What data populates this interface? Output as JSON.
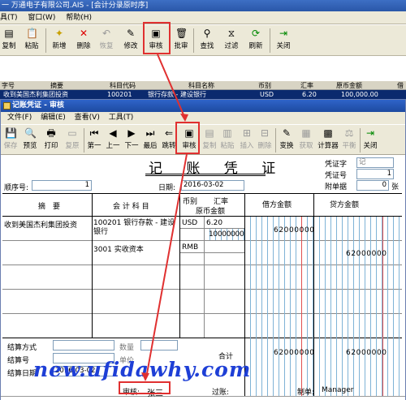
{
  "outer": {
    "title": "一 万通电子有限公司.AIS - [会计分录原时序]",
    "menu": [
      "具(T)",
      "窗口(W)",
      "帮助(H)"
    ],
    "toolbar": [
      "复制",
      "粘贴",
      "新增",
      "删除",
      "恢复",
      "修改",
      "审核",
      "批审",
      "查找",
      "过滤",
      "刷新",
      "关闭"
    ],
    "grid": {
      "headers": [
        "字号",
        "摘要",
        "科目代码",
        "科目名称",
        "币别",
        "汇率",
        "原币金额",
        "借"
      ],
      "row": [
        "",
        "收到美国杰利集团投资",
        "100201",
        "银行存款 - 建设银行",
        "USD",
        "6.20",
        "100,000.00",
        ""
      ]
    }
  },
  "inner": {
    "title": "记账凭证 - 审核",
    "menu": [
      "文件(F)",
      "编辑(E)",
      "查看(V)",
      "工具(T)"
    ],
    "toolbar": [
      "保存",
      "预览",
      "打印",
      "复原",
      "第一",
      "上一",
      "下一",
      "最后",
      "跳转",
      "审核",
      "复制",
      "粘贴",
      "插入",
      "删除",
      "变换",
      "获取",
      "计算器",
      "平衡",
      "关闭"
    ],
    "voucher": {
      "title": "记 账 凭 证",
      "type_label": "凭证字",
      "type_value": "记",
      "no_label": "凭证号",
      "no_value": "1",
      "attach_label": "附单据",
      "attach_value": "0",
      "attach_unit": "张",
      "seq_label": "顺序号:",
      "seq_value": "1",
      "date_label": "日期:",
      "date_value": "2016-03-02",
      "col_summary": "摘　要",
      "col_account": "会 计 科 目",
      "col_currency": "币别",
      "col_rate": "汇率",
      "col_orig": "原币金额",
      "col_debit": "借方金额",
      "col_credit": "贷方金额",
      "rows": [
        {
          "summary": "收到美国杰利集团投资",
          "account": "100201 银行存款 - 建设银行",
          "currency": "USD",
          "rate": "6.20",
          "orig": "10000000",
          "debit": "62000000",
          "credit": ""
        },
        {
          "summary": "",
          "account": "3001 实收资本",
          "currency": "RMB",
          "rate": "",
          "orig": "",
          "debit": "",
          "credit": "62000000"
        }
      ],
      "settle_method": "结算方式",
      "quantity": "数量",
      "settle_no": "结算号",
      "unit_price": "单价",
      "settle_date": "结算日期",
      "settle_date_value": "2016-03-02",
      "total_label": "合计",
      "total_debit": "62000000",
      "total_credit": "62000000"
    },
    "status": {
      "audit_label": "审核:",
      "audit_value": "张三",
      "post_label": "过账:",
      "post_value": "",
      "maker_label": "制单:",
      "maker_value": "Manager"
    }
  },
  "watermark": "new.ufidawhy.com"
}
